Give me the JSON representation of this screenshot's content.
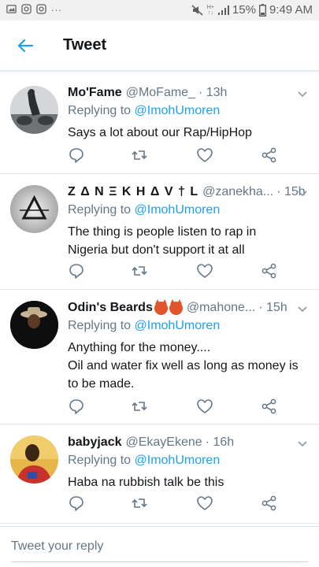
{
  "status_bar": {
    "notification_dots": "...",
    "network_type": "H+",
    "network_sub": "↑↓",
    "battery_percent": "15%",
    "time": "9:49 AM"
  },
  "header": {
    "title": "Tweet"
  },
  "tweets": [
    {
      "name": "Mo'Fame",
      "handle": "@MoFame_",
      "time": "· 13h",
      "replying_prefix": "Replying to",
      "replying_to": "@ImohUmoren",
      "lines": [
        "Says a lot about our Rap/HipHop"
      ]
    },
    {
      "name": "Z Δ N Ξ K H Δ V † L",
      "handle": "@zanekha...",
      "time": "· 15h",
      "replying_prefix": "Replying to",
      "replying_to": "@ImohUmoren",
      "lines": [
        "The thing is people listen to rap in",
        "Nigeria but don't support it at all"
      ]
    },
    {
      "name": "Odin's Beards",
      "handle": "@mahone...",
      "time": "· 15h",
      "replying_prefix": "Replying to",
      "replying_to": "@ImohUmoren",
      "lines": [
        "Anything for the money....",
        "Oil and water fix well as long as money is",
        "to be made."
      ]
    },
    {
      "name": "babyjack",
      "handle": "@EkayEkene",
      "time": "· 16h",
      "replying_prefix": "Replying to",
      "replying_to": "@ImohUmoren",
      "lines": [
        "Haba na rubbish talk be this"
      ]
    }
  ],
  "composer": {
    "placeholder": "Tweet your reply"
  },
  "colors": {
    "accent": "#1da1f2",
    "secondary_text": "#657786",
    "icon": "#657786"
  }
}
